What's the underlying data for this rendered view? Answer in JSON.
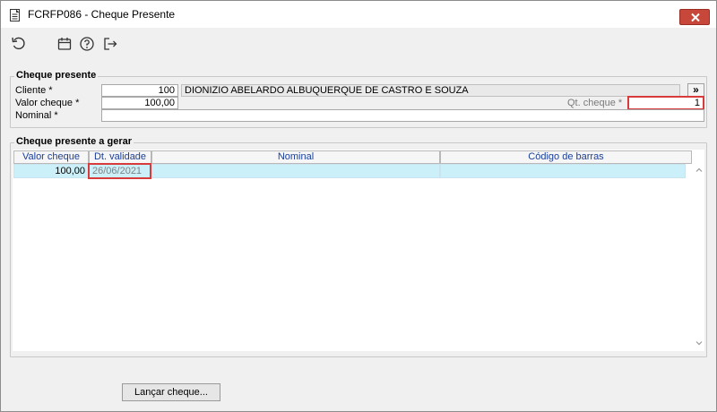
{
  "window": {
    "title": "FCRFP086 - Cheque Presente"
  },
  "icons": {
    "app": "document-icon",
    "refresh": "refresh-icon",
    "calendar": "calendar-icon",
    "help": "help-icon",
    "exit": "exit-icon",
    "close": "close-icon",
    "nav": "double-chevron-right-icon"
  },
  "colors": {
    "close_button": "#c7473a",
    "grid_row": "#ccf0fa",
    "grid_header_text": "#1a3e9a",
    "highlight": "#d83b3b"
  },
  "cheque_presente": {
    "group_label": "Cheque presente",
    "cliente_label": "Cliente *",
    "cliente_code": "100",
    "cliente_name": "DIONIZIO ABELARDO ALBUQUERQUE DE CASTRO E SOUZA",
    "nav_button": "»",
    "valor_label": "Valor cheque *",
    "valor_value": "100,00",
    "qt_label": "Qt. cheque *",
    "qt_value": "1",
    "nominal_label": "Nominal *",
    "nominal_value": ""
  },
  "cheque_gerar": {
    "group_label": "Cheque presente a gerar",
    "columns": [
      "Valor cheque",
      "Dt. validade",
      "Nominal",
      "Código de barras"
    ],
    "rows": [
      {
        "valor": "100,00",
        "validade": "26/06/2021",
        "nominal": "",
        "codigo": ""
      }
    ]
  },
  "actions": {
    "launch_button": "Lançar cheque..."
  }
}
